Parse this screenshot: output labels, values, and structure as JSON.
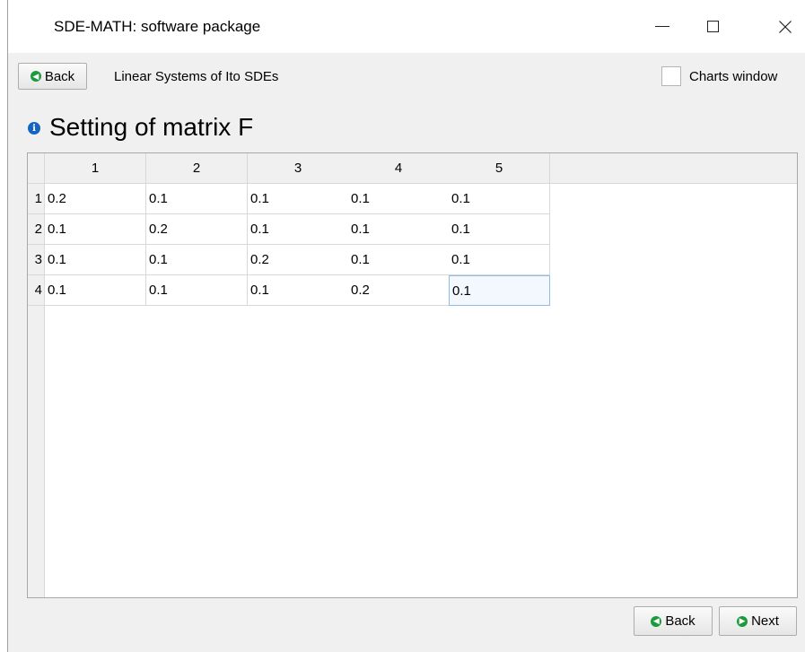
{
  "window": {
    "title": "SDE-MATH: software package"
  },
  "toolbar": {
    "back_label": "Back",
    "subtitle": "Linear Systems of Ito SDEs",
    "charts_label": "Charts window",
    "charts_checked": false
  },
  "heading": "Setting of matrix F",
  "table": {
    "columns": [
      "1",
      "2",
      "3",
      "4",
      "5"
    ],
    "rows": [
      {
        "label": "1",
        "cells": [
          "0.2",
          "0.1",
          "0.1",
          "0.1",
          "0.1"
        ]
      },
      {
        "label": "2",
        "cells": [
          "0.1",
          "0.2",
          "0.1",
          "0.1",
          "0.1"
        ]
      },
      {
        "label": "3",
        "cells": [
          "0.1",
          "0.1",
          "0.2",
          "0.1",
          "0.1"
        ]
      },
      {
        "label": "4",
        "cells": [
          "0.1",
          "0.1",
          "0.1",
          "0.2",
          "0.1"
        ]
      }
    ],
    "selected_cell": {
      "row": 4,
      "col": 5
    }
  },
  "footer": {
    "back_label": "Back",
    "next_label": "Next"
  },
  "icons": {
    "back": "arrow-left-circle-icon",
    "next": "arrow-right-circle-icon",
    "info": "info-icon",
    "accent_color": "#1a9b3c",
    "info_color": "#1565c0"
  }
}
